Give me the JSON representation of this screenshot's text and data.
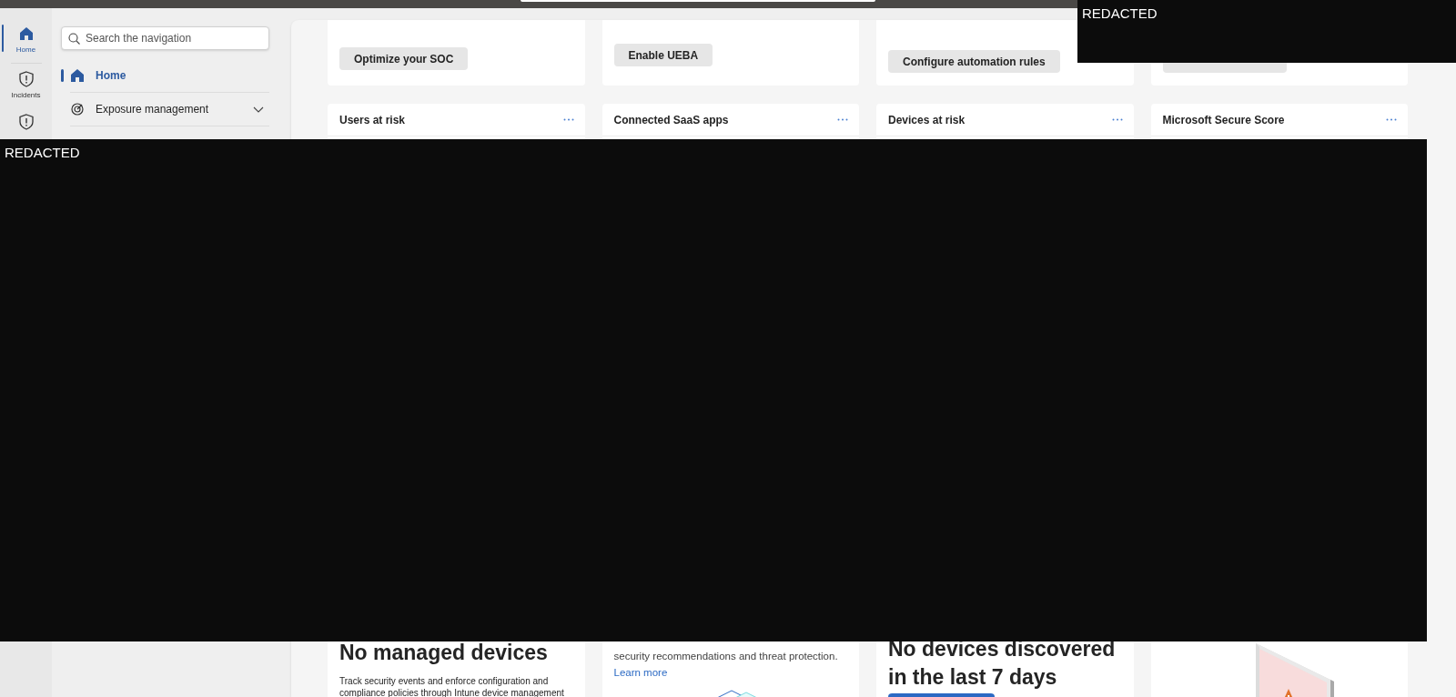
{
  "rail": [
    {
      "label": "Home",
      "selected": true
    },
    {
      "label": "Incidents",
      "selected": false
    },
    {
      "selected": false
    }
  ],
  "nav": {
    "search_placeholder": "Search the navigation",
    "items": [
      {
        "label": "Home",
        "selected": true,
        "expandable": false
      },
      {
        "label": "Exposure management",
        "selected": false,
        "expandable": true
      }
    ]
  },
  "action_cards": [
    {
      "kind": "button",
      "button": "Optimize your SOC"
    },
    {
      "kind": "button",
      "button": "Enable UEBA"
    },
    {
      "kind": "button",
      "button": "Configure automation rules"
    },
    {
      "kind": "covered_button"
    }
  ],
  "widgets": [
    {
      "title": "Users at risk"
    },
    {
      "title": "Connected SaaS apps"
    },
    {
      "title": "Devices at risk"
    },
    {
      "title": "Microsoft Secure Score"
    }
  ],
  "lower_cards": [
    {
      "kind": "empty",
      "title": "No managed devices",
      "text": "Track security events and enforce configuration and compliance policies through Intune device management"
    },
    {
      "kind": "info",
      "text": "security recommendations and threat protection.",
      "link": "Learn more"
    },
    {
      "kind": "empty_action",
      "title": "No devices discovered in the last 7 days"
    },
    {
      "kind": "illustration"
    }
  ],
  "redactions": [
    {
      "label": "REDACTED"
    },
    {
      "label": "REDACTED"
    }
  ]
}
